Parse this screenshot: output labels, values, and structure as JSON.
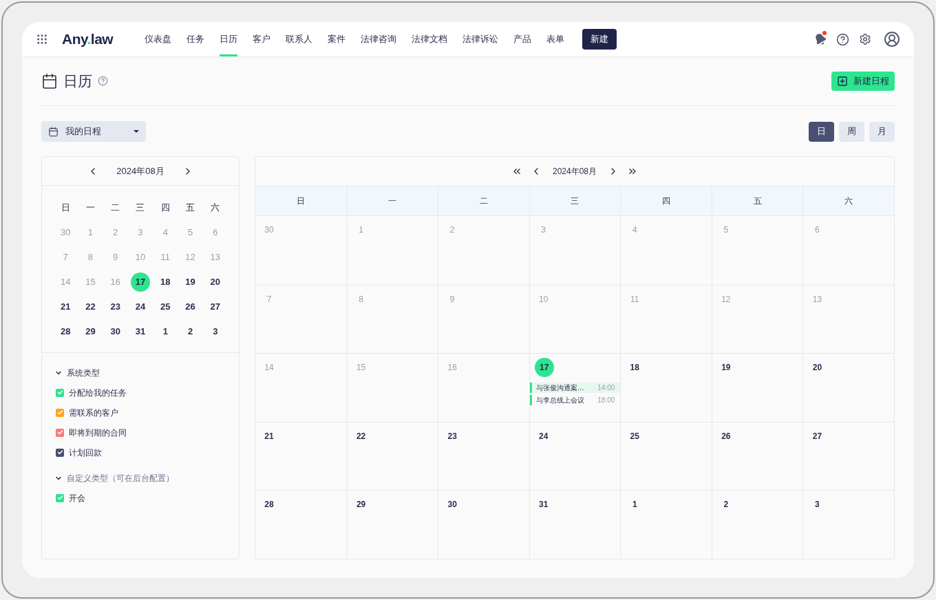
{
  "brand": {
    "name_left": "Any",
    "name_dot": ".",
    "name_right": "law"
  },
  "nav": [
    {
      "label": "仪表盘",
      "selected": false
    },
    {
      "label": "任务",
      "selected": false
    },
    {
      "label": "日历",
      "selected": true
    },
    {
      "label": "客户",
      "selected": false
    },
    {
      "label": "联系人",
      "selected": false
    },
    {
      "label": "案件",
      "selected": false
    },
    {
      "label": "法律咨询",
      "selected": false
    },
    {
      "label": "法律文档",
      "selected": false
    },
    {
      "label": "法律诉讼",
      "selected": false
    },
    {
      "label": "产品",
      "selected": false
    },
    {
      "label": "表单",
      "selected": false
    }
  ],
  "new_button": "新建",
  "notifications": {
    "unread": true
  },
  "page": {
    "title": "日历",
    "new_event_button": "新建日程",
    "calendar_select": "我的日程"
  },
  "views": [
    {
      "label": "日",
      "selected": true
    },
    {
      "label": "周",
      "selected": false
    },
    {
      "label": "月",
      "selected": false
    }
  ],
  "mini_calendar": {
    "month": "2024年08月",
    "weekdays": [
      "日",
      "一",
      "二",
      "三",
      "四",
      "五",
      "六"
    ],
    "days": [
      {
        "label": "30",
        "past": true,
        "selected": false
      },
      {
        "label": "1",
        "past": true,
        "selected": false
      },
      {
        "label": "2",
        "past": true,
        "selected": false
      },
      {
        "label": "3",
        "past": true,
        "selected": false
      },
      {
        "label": "4",
        "past": true,
        "selected": false
      },
      {
        "label": "5",
        "past": true,
        "selected": false
      },
      {
        "label": "6",
        "past": true,
        "selected": false
      },
      {
        "label": "7",
        "past": true,
        "selected": false
      },
      {
        "label": "8",
        "past": true,
        "selected": false
      },
      {
        "label": "9",
        "past": true,
        "selected": false
      },
      {
        "label": "10",
        "past": true,
        "selected": false
      },
      {
        "label": "11",
        "past": true,
        "selected": false
      },
      {
        "label": "12",
        "past": true,
        "selected": false
      },
      {
        "label": "13",
        "past": true,
        "selected": false
      },
      {
        "label": "14",
        "past": true,
        "selected": false
      },
      {
        "label": "15",
        "past": true,
        "selected": false
      },
      {
        "label": "16",
        "past": true,
        "selected": false
      },
      {
        "label": "17",
        "past": false,
        "selected": true
      },
      {
        "label": "18",
        "past": false,
        "selected": false
      },
      {
        "label": "19",
        "past": false,
        "selected": false
      },
      {
        "label": "20",
        "past": false,
        "selected": false
      },
      {
        "label": "21",
        "past": false,
        "selected": false
      },
      {
        "label": "22",
        "past": false,
        "selected": false
      },
      {
        "label": "23",
        "past": false,
        "selected": false
      },
      {
        "label": "24",
        "past": false,
        "selected": false
      },
      {
        "label": "25",
        "past": false,
        "selected": false
      },
      {
        "label": "26",
        "past": false,
        "selected": false
      },
      {
        "label": "27",
        "past": false,
        "selected": false
      },
      {
        "label": "28",
        "past": false,
        "selected": false
      },
      {
        "label": "29",
        "past": false,
        "selected": false
      },
      {
        "label": "30",
        "past": false,
        "selected": false
      },
      {
        "label": "31",
        "past": false,
        "selected": false
      },
      {
        "label": "1",
        "past": false,
        "selected": false
      },
      {
        "label": "2",
        "past": false,
        "selected": false
      },
      {
        "label": "3",
        "past": false,
        "selected": false
      }
    ]
  },
  "filter_groups": [
    {
      "title": "系统类型",
      "expanded": true,
      "items": [
        {
          "label": "分配给我的任务",
          "checked": true,
          "color": "#2ee58f"
        },
        {
          "label": "需联系的客户",
          "checked": true,
          "color": "#ffa31a"
        },
        {
          "label": "即将到期的合同",
          "checked": true,
          "color": "#f87a7a"
        },
        {
          "label": "计划回款",
          "checked": true,
          "color": "#4a5072"
        }
      ]
    },
    {
      "title": "自定义类型（可在后台配置）",
      "expanded": true,
      "items": [
        {
          "label": "开会",
          "checked": true,
          "color": "#2ee58f"
        }
      ]
    }
  ],
  "calendar": {
    "month": "2024年08月",
    "weekdays": [
      "日",
      "一",
      "二",
      "三",
      "四",
      "五",
      "六"
    ],
    "days": [
      {
        "label": "30",
        "past": true,
        "selected": false
      },
      {
        "label": "1",
        "past": true,
        "selected": false
      },
      {
        "label": "2",
        "past": true,
        "selected": false
      },
      {
        "label": "3",
        "past": true,
        "selected": false
      },
      {
        "label": "4",
        "past": true,
        "selected": false
      },
      {
        "label": "5",
        "past": true,
        "selected": false
      },
      {
        "label": "6",
        "past": true,
        "selected": false
      },
      {
        "label": "7",
        "past": true,
        "selected": false
      },
      {
        "label": "8",
        "past": true,
        "selected": false
      },
      {
        "label": "9",
        "past": true,
        "selected": false
      },
      {
        "label": "10",
        "past": true,
        "selected": false
      },
      {
        "label": "11",
        "past": true,
        "selected": false
      },
      {
        "label": "12",
        "past": true,
        "selected": false
      },
      {
        "label": "13",
        "past": true,
        "selected": false
      },
      {
        "label": "14",
        "past": true,
        "selected": false
      },
      {
        "label": "15",
        "past": true,
        "selected": false
      },
      {
        "label": "16",
        "past": true,
        "selected": false
      },
      {
        "label": "17",
        "past": false,
        "selected": true,
        "events": [
          {
            "title": "与张俊沟通案…",
            "time": "14:00",
            "selected": true,
            "color": "#2ee58f"
          },
          {
            "title": "与李总线上会议",
            "time": "18:00",
            "selected": false,
            "color": "#2ee58f"
          }
        ]
      },
      {
        "label": "18",
        "past": false,
        "selected": false
      },
      {
        "label": "19",
        "past": false,
        "selected": false
      },
      {
        "label": "20",
        "past": false,
        "selected": false
      },
      {
        "label": "21",
        "past": false,
        "selected": false
      },
      {
        "label": "22",
        "past": false,
        "selected": false
      },
      {
        "label": "23",
        "past": false,
        "selected": false
      },
      {
        "label": "24",
        "past": false,
        "selected": false
      },
      {
        "label": "25",
        "past": false,
        "selected": false
      },
      {
        "label": "26",
        "past": false,
        "selected": false
      },
      {
        "label": "27",
        "past": false,
        "selected": false
      },
      {
        "label": "28",
        "past": false,
        "selected": false
      },
      {
        "label": "29",
        "past": false,
        "selected": false
      },
      {
        "label": "30",
        "past": false,
        "selected": false
      },
      {
        "label": "31",
        "past": false,
        "selected": false
      },
      {
        "label": "1",
        "past": false,
        "selected": false
      },
      {
        "label": "2",
        "past": false,
        "selected": false
      },
      {
        "label": "3",
        "past": false,
        "selected": false
      }
    ]
  }
}
